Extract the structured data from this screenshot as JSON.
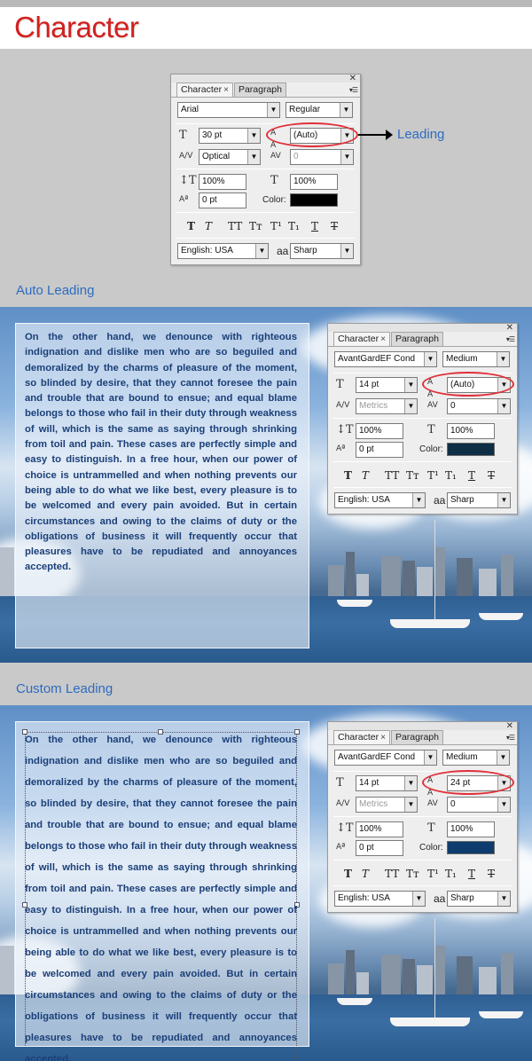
{
  "header": {
    "title": "Character"
  },
  "annotation": {
    "leading_label": "Leading"
  },
  "sections": {
    "auto": {
      "label": "Auto Leading"
    },
    "custom": {
      "label": "Custom Leading"
    }
  },
  "panel_tabs": {
    "character": "Character",
    "paragraph": "Paragraph"
  },
  "panels": {
    "top": {
      "font_family": "Arial",
      "font_style": "Regular",
      "font_size": "30 pt",
      "leading": "(Auto)",
      "kerning": "Optical",
      "tracking": "0",
      "vertical_scale": "100%",
      "horizontal_scale": "100%",
      "baseline_shift": "0 pt",
      "color_label": "Color:",
      "color": "#000000",
      "language": "English: USA",
      "antialias": "Sharp"
    },
    "auto": {
      "font_family": "AvantGardEF Cond",
      "font_style": "Medium",
      "font_size": "14 pt",
      "leading": "(Auto)",
      "kerning": "Metrics",
      "tracking": "0",
      "vertical_scale": "100%",
      "horizontal_scale": "100%",
      "baseline_shift": "0 pt",
      "color_label": "Color:",
      "color": "#0e2e45",
      "language": "English: USA",
      "antialias": "Sharp"
    },
    "custom": {
      "font_family": "AvantGardEF Cond",
      "font_style": "Medium",
      "font_size": "14 pt",
      "leading": "24 pt",
      "kerning": "Metrics",
      "tracking": "0",
      "vertical_scale": "100%",
      "horizontal_scale": "100%",
      "baseline_shift": "0 pt",
      "color_label": "Color:",
      "color": "#0e3c6e",
      "language": "English: USA",
      "antialias": "Sharp"
    }
  },
  "icons": {
    "aa": "aa"
  },
  "sample_text": "On the other hand, we denounce with righteous indignation and dislike men who are so beguiled and demoralized by the charms of pleasure of the moment, so blinded by desire, that they cannot foresee the pain and trouble that are bound to ensue; and equal blame belongs to those who fail in their duty through weakness of will, which is the same as saying through shrinking from toil and pain. These cases are perfectly simple and easy to distinguish. In a free hour, when our power of choice is untrammelled and when nothing prevents our being able to do what we like best, every pleasure is to be welcomed and every pain avoided. But in certain circumstances and owing to the claims of duty or the obligations of business it will frequently occur that pleasures have to be repudiated and annoyances accepted."
}
